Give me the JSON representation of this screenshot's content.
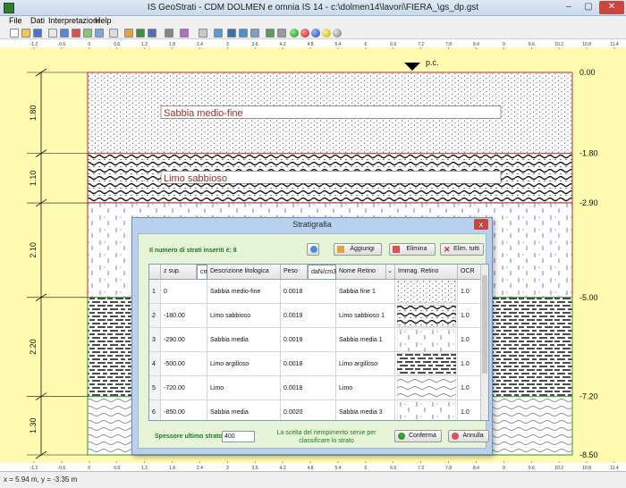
{
  "window": {
    "title": "IS GeoStrati - CDM DOLMEN e omnia IS 14 - c:\\dolmen14\\lavori\\FIERA_\\gs_dp.gst"
  },
  "menu": [
    "File",
    "Dati",
    "Interpretazioni",
    "Help"
  ],
  "ruler": {
    "ticks": [
      "-1.2",
      "-0.6",
      "0",
      "0.6",
      "1.2",
      "1.8",
      "2.4",
      "3",
      "3.6",
      "4.2",
      "4.8",
      "5.4",
      "6",
      "6.6",
      "7.2",
      "7.8",
      "8.4",
      "9",
      "9.6",
      "10.2",
      "10.8",
      "11.4"
    ],
    "ground_label": "p.c."
  },
  "strata": [
    {
      "name": "Sabbia medio-fine",
      "top": 0.0,
      "bottom": 1.8,
      "thickness": "1.80",
      "top_label": "0.00",
      "bottom_label": "-1.80",
      "pattern": "dots",
      "border": "#c0504d"
    },
    {
      "name": "Limo sabbioso",
      "top": 1.8,
      "bottom": 2.9,
      "thickness": "1.10",
      "top_label": "-1.80",
      "bottom_label": "-2.90",
      "pattern": "waves",
      "border": "#c0504d"
    },
    {
      "name": "Sabbia media",
      "top": 2.9,
      "bottom": 5.0,
      "thickness": "2.10",
      "top_label": "-2.90",
      "bottom_label": "-5.00",
      "pattern": "dashes",
      "border": "#c0504d"
    },
    {
      "name": "Limo argilloso",
      "top": 5.0,
      "bottom": 7.2,
      "thickness": "2.20",
      "top_label": "-5.00",
      "bottom_label": "-7.20",
      "pattern": "bricks",
      "border": "#4aa84a"
    },
    {
      "name": "Limo",
      "top": 7.2,
      "bottom": 8.5,
      "thickness": "1.30",
      "top_label": "-7.20",
      "bottom_label": "-8.50",
      "pattern": "softwaves",
      "border": "#4aa84a"
    }
  ],
  "status": "x = 5.94 m, y = -3.35 m",
  "dialog": {
    "title": "Stratigrafia",
    "close": "x",
    "count_text": "Il numero di strati inseriti è:  8",
    "buttons": {
      "add": "Aggiungi",
      "delete": "Elimina",
      "delete_all": "Elim. tutti",
      "confirm": "Conferma",
      "cancel": "Annulla"
    },
    "columns": [
      "",
      "z sup.",
      "cm",
      "Descrizione litologica",
      "Peso",
      "daN/cm3",
      "Nome Retino",
      "",
      "Immag. Retino",
      "OCR"
    ],
    "rows": [
      {
        "n": "1",
        "z": "0",
        "desc": "Sabbia medio-fine",
        "peso": "0.0018",
        "retino": "Sabbia fine 1",
        "ocr": "1.0",
        "pattern": "dots"
      },
      {
        "n": "2",
        "z": "-180.00",
        "desc": "Limo sabbioso",
        "peso": "0.0019",
        "retino": "Limo sabbioso 1",
        "ocr": "1.0",
        "pattern": "waves"
      },
      {
        "n": "3",
        "z": "-290.00",
        "desc": "Sabbia media",
        "peso": "0.0019",
        "retino": "Sabbia media 1",
        "ocr": "1.0",
        "pattern": "dashes"
      },
      {
        "n": "4",
        "z": "-500.00",
        "desc": "Limo argilloso",
        "peso": "0.0018",
        "retino": "Limo argilloso",
        "ocr": "1.0",
        "pattern": "bricks"
      },
      {
        "n": "5",
        "z": "-720.00",
        "desc": "Limo",
        "peso": "0.0018",
        "retino": "Limo",
        "ocr": "1.0",
        "pattern": "softwaves"
      },
      {
        "n": "6",
        "z": "-850.00",
        "desc": "Sabbia media",
        "peso": "0.0020",
        "retino": "Sabbia media 3",
        "ocr": "1.0",
        "pattern": "dashes"
      }
    ],
    "spessore_label": "Spessore ultimo strato",
    "spessore_value": "400",
    "note": "La scelta del riempimento serve per classificare lo strato"
  }
}
